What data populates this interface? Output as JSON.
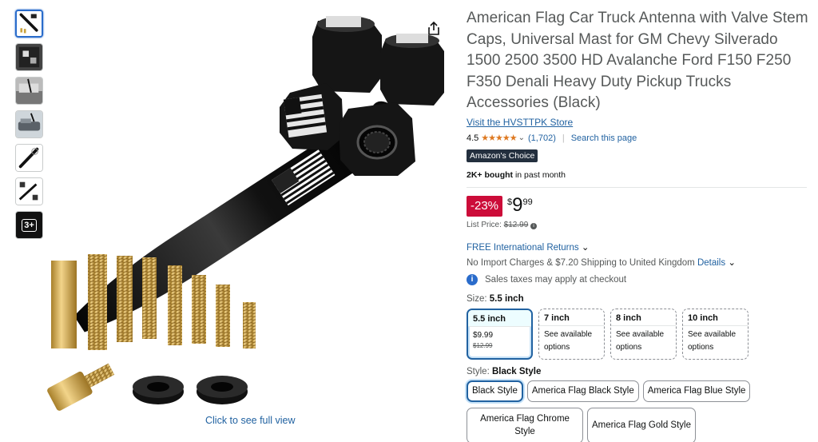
{
  "thumbnails": [
    {
      "name": "thumb-1",
      "selected": true
    },
    {
      "name": "thumb-2",
      "selected": false
    },
    {
      "name": "thumb-3",
      "selected": false
    },
    {
      "name": "thumb-4",
      "selected": false
    },
    {
      "name": "thumb-5",
      "selected": false
    },
    {
      "name": "thumb-6",
      "selected": false
    }
  ],
  "more_thumbs_label": "3+",
  "main_image": {
    "full_view_label": "Click to see full view",
    "share_icon": "share-icon"
  },
  "product": {
    "title": "American Flag Car Truck Antenna with Valve Stem Caps, Universal Mast for GM Chevy Silverado 1500 2500 3500 HD Avalanche Ford F150 F250 F350 Denali Heavy Duty Pickup Trucks Accessories (Black)",
    "store_link": "Visit the HVSTTPK Store",
    "rating": "4.5",
    "stars": "★★★★★",
    "rating_count": "(1,702)",
    "search_page": "Search this page",
    "badge": "Amazon's Choice",
    "bought_bold": "2K+ bought",
    "bought_rest": " in past month"
  },
  "price": {
    "discount": "-23%",
    "symbol": "$",
    "whole": "9",
    "fraction": "99",
    "list_label": "List Price: ",
    "list_value": "$12.99"
  },
  "delivery": {
    "returns": "FREE International Returns",
    "shipping": "No Import Charges & $7.20 Shipping to United Kingdom ",
    "details_link": "Details",
    "tax": "Sales taxes may apply at checkout"
  },
  "size": {
    "label": "Size: ",
    "selected": "5.5 inch",
    "options": [
      {
        "name": "5.5 inch",
        "line1": "$9.99",
        "line2": "$12.99"
      },
      {
        "name": "7 inch",
        "line1": "See available",
        "line2": "options"
      },
      {
        "name": "8 inch",
        "line1": "See available",
        "line2": "options"
      },
      {
        "name": "10 inch",
        "line1": "See available",
        "line2": "options"
      }
    ]
  },
  "style": {
    "label": "Style: ",
    "selected": "Black Style",
    "options": [
      "Black Style",
      "America Flag Black Style",
      "America Flag Blue Style",
      "America Flag Chrome Style",
      "America Flag Gold Style"
    ]
  },
  "colors": {
    "link": "#2162a1",
    "discount": "#cc0c39",
    "badge": "#232f3e",
    "star": "#de7921"
  }
}
